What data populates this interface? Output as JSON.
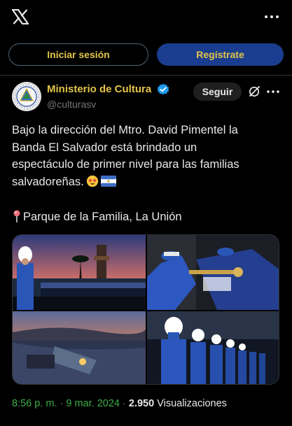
{
  "header": {
    "logo_icon": "x-logo-icon",
    "more_icon": "more-horizontal-icon"
  },
  "auth": {
    "login_label": "Iniciar sesión",
    "signup_label": "Regístrate"
  },
  "post": {
    "author_name": "Ministerio de Cultura",
    "author_handle": "@culturasv",
    "verified_icon": "verified-badge-icon",
    "follow_label": "Seguir",
    "text_line1": "Bajo la dirección del Mtro. David Pimentel la",
    "text_line2": "Banda El Salvador está brindado un",
    "text_line3": "espectáculo de primer nivel para las familias",
    "text_line4": "salvadoreñas.",
    "location": "Parque de la Familia, La Unión",
    "time": "8:56 p. m.",
    "date": "9 mar. 2024",
    "views_count": "2.950",
    "views_label": "Visualizaciones",
    "separator": "·"
  },
  "colors": {
    "accent_gold": "#e3c54a",
    "signup_blue": "#1b3d8f",
    "verified_blue": "#1d9bf0",
    "time_green": "#3fae49"
  }
}
